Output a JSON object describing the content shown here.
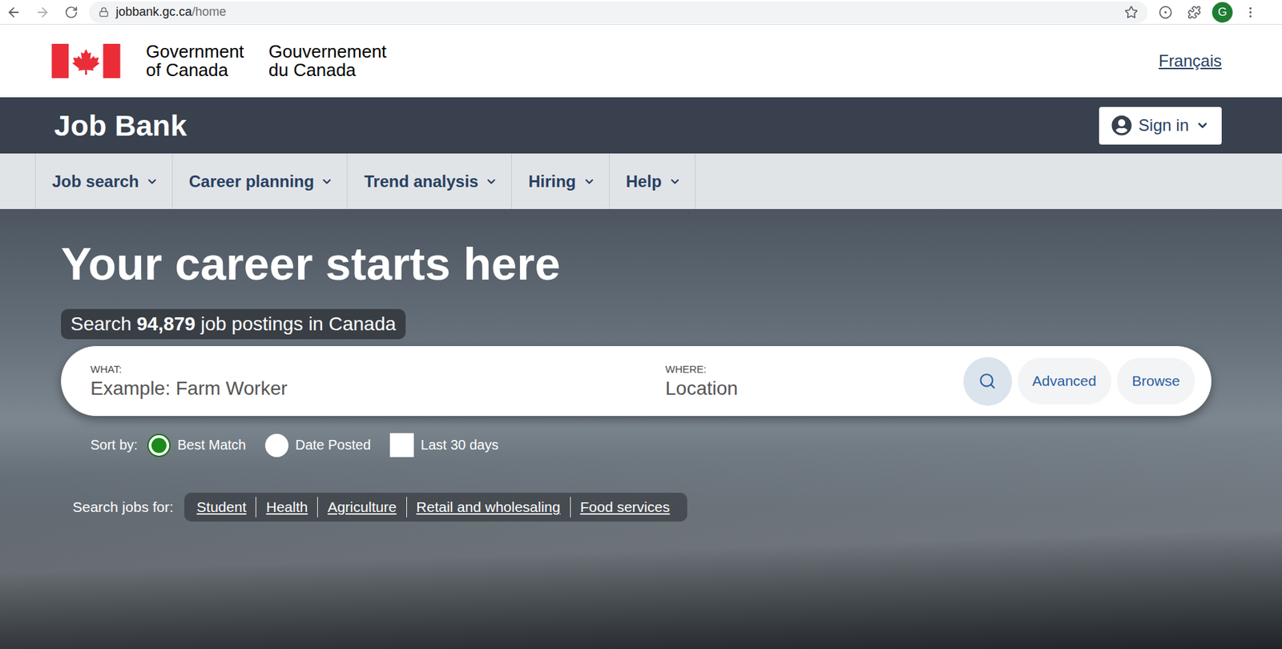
{
  "browser": {
    "url_host": "jobbank.gc.ca",
    "url_path": "/home",
    "profile_initial": "G"
  },
  "header": {
    "english": [
      "Government",
      "of Canada"
    ],
    "french": [
      "Gouvernement",
      "du Canada"
    ],
    "language_toggle": "Français"
  },
  "site_bar": {
    "title": "Job Bank",
    "sign_in": "Sign in"
  },
  "nav": [
    {
      "label": "Job search"
    },
    {
      "label": "Career planning"
    },
    {
      "label": "Trend analysis"
    },
    {
      "label": "Hiring"
    },
    {
      "label": "Help"
    }
  ],
  "hero": {
    "title": "Your career starts here",
    "count_prefix": "Search",
    "count": "94,879",
    "count_suffix": "job postings in Canada"
  },
  "search": {
    "what_label": "WHAT:",
    "what_placeholder": "Example: Farm Worker",
    "where_label": "WHERE:",
    "where_placeholder": "Location",
    "buttons": [
      "Advanced",
      "Browse"
    ]
  },
  "sort": {
    "label": "Sort by:",
    "options": [
      {
        "label": "Best Match",
        "selected": true
      },
      {
        "label": "Date Posted",
        "selected": false
      }
    ],
    "filter": {
      "label": "Last 30 days",
      "checked": false
    }
  },
  "quick_links": {
    "label": "Search jobs for:",
    "links": [
      "Student",
      "Health",
      "Agriculture",
      "Retail and wholesaling",
      "Food services"
    ]
  }
}
